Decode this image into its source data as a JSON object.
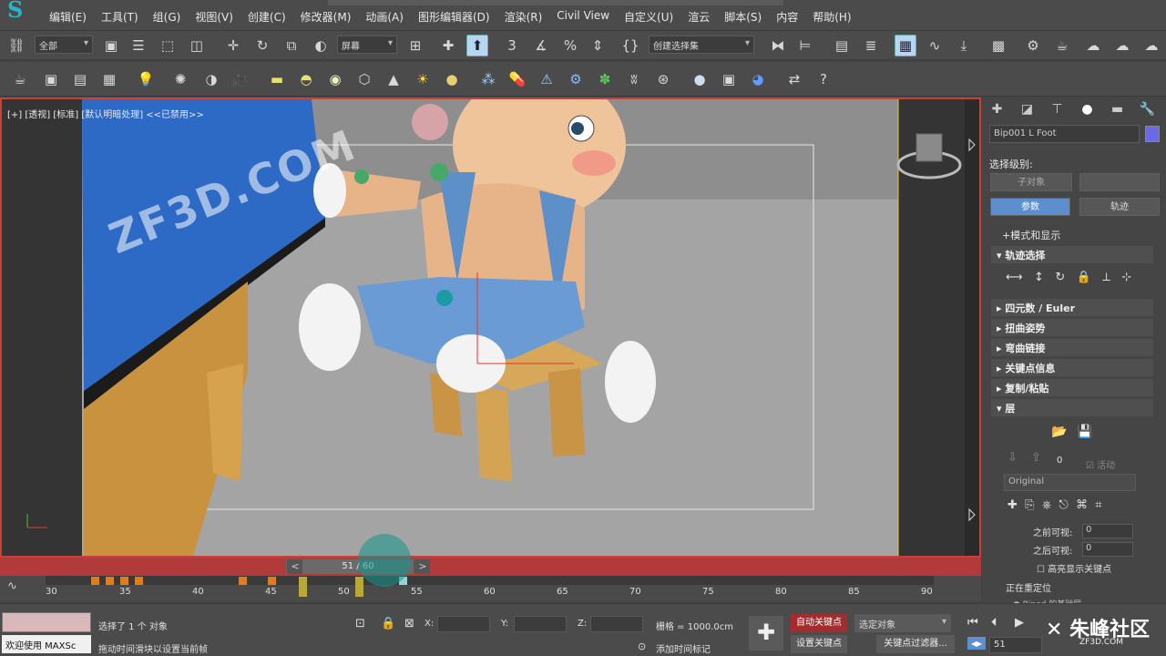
{
  "menu": {
    "logo_text": "S",
    "items": [
      "编辑(E)",
      "工具(T)",
      "组(G)",
      "视图(V)",
      "创建(C)",
      "修改器(M)",
      "动画(A)",
      "图形编辑器(D)",
      "渲染(R)",
      "Civil View",
      "自定义(U)",
      "渲云",
      "脚本(S)",
      "内容",
      "帮助(H)"
    ]
  },
  "toolbar": {
    "filter_dropdown": "全部",
    "coord_dropdown": "屏幕",
    "selection_set_dropdown": "创建选择集"
  },
  "viewport": {
    "label": "[+] [透视] [标准] [默认明暗处理] <<已禁用>>",
    "watermark": "ZF3D.COM",
    "gizmo_x": "x",
    "gizmo_y": "y"
  },
  "timeslider": {
    "prev": "<",
    "next": ">",
    "position": "51 / 60",
    "current_frame": 51,
    "total_frames": 60
  },
  "trackbar": {
    "ticks": [
      "30",
      "35",
      "40",
      "45",
      "50",
      "55",
      "60",
      "65",
      "70",
      "75",
      "80",
      "85",
      "90"
    ]
  },
  "command_panel": {
    "object_name": "Bip001 L Foot",
    "color": "#6a6ae8",
    "selection_level_label": "选择级别:",
    "subobject_button": "子对象",
    "params_button": "参数",
    "trajectory_button": "轨迹",
    "mode_display": "+模式和显示",
    "rollouts": [
      "轨迹选择",
      "四元数 / Euler",
      "扭曲姿势",
      "弯曲链接",
      "关键点信息",
      "复制/粘贴",
      "层"
    ],
    "layer_index": "0",
    "layer_active_label": "活动",
    "layer_name": "Original",
    "before_visible_label": "之前可视:",
    "before_visible_value": "0",
    "after_visible_label": "之后可视:",
    "after_visible_value": "0",
    "highlight_keys_label": "高亮显示关键点",
    "ik_label": "正在重定位",
    "ik_sub_label": "Biped 的基础层"
  },
  "status": {
    "welcome": "欢迎使用 MAXSc",
    "selected": "选择了 1 个 对象",
    "hint": "拖动时间滑块以设置当前帧",
    "x_label": "X:",
    "y_label": "Y:",
    "z_label": "Z:",
    "grid": "栅格 = 1000.0cm",
    "add_time_tag": "添加时间标记",
    "auto_key": "自动关键点",
    "set_key": "设置关键点",
    "selected_object": "选定对象",
    "key_filter": "关键点过滤器...",
    "frame_field": "51",
    "brand": "朱峰社区",
    "brand_url": "ZF3D.COM"
  }
}
